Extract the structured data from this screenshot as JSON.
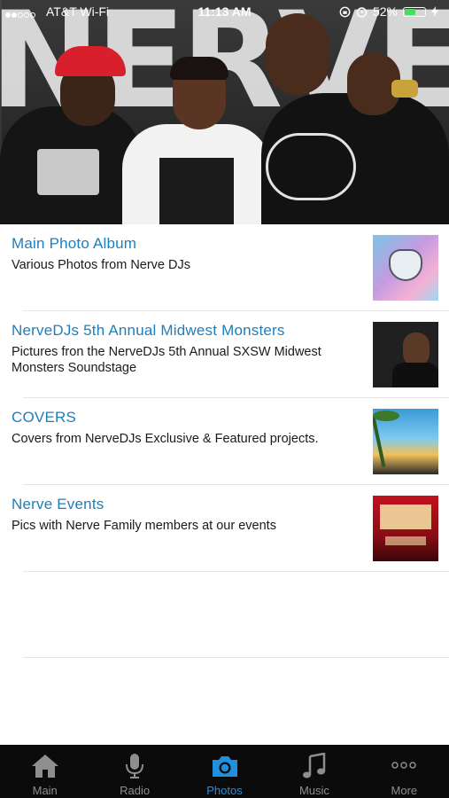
{
  "status_bar": {
    "carrier": "AT&T Wi-Fi",
    "time": "11:13 AM",
    "battery": "52%",
    "battery_level": 0.52
  },
  "albums": [
    {
      "title": "Main Photo Album",
      "description": "Various Photos from Nerve DJs",
      "thumb_icon": "album-cover-icon"
    },
    {
      "title": "NerveDJs 5th Annual Midwest Monsters",
      "description": "Pictures fron the NerveDJs 5th Annual SXSW Midwest Monsters Soundstage",
      "thumb_icon": "portrait-icon"
    },
    {
      "title": "COVERS",
      "description": "Covers from NerveDJs Exclusive & Featured projects.",
      "thumb_icon": "beach-cover-icon"
    },
    {
      "title": "Nerve Events",
      "description": "Pics with Nerve Family members at our events",
      "thumb_icon": "event-flyer-icon"
    }
  ],
  "tabbar": {
    "tabs": [
      {
        "label": "Main",
        "icon": "home-icon",
        "active": false
      },
      {
        "label": "Radio",
        "icon": "microphone-icon",
        "active": false
      },
      {
        "label": "Photos",
        "icon": "camera-icon",
        "active": true
      },
      {
        "label": "Music",
        "icon": "music-note-icon",
        "active": false
      },
      {
        "label": "More",
        "icon": "more-dots-icon",
        "active": false
      }
    ],
    "active_color": "#1f8fe0",
    "inactive_color": "#8e8e8e"
  },
  "colors": {
    "title": "#1c7fbd",
    "tabbar_bg": "#0b0b0b"
  }
}
